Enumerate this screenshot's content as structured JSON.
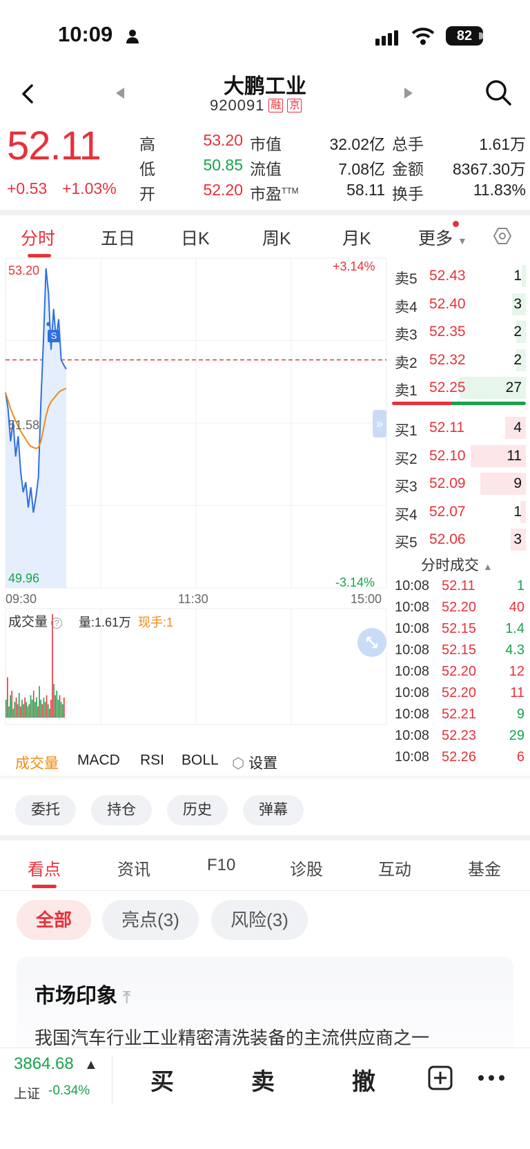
{
  "status": {
    "time": "10:09",
    "battery": "82"
  },
  "header": {
    "name": "大鹏工业",
    "code": "920091",
    "tag1": "融",
    "tag2": "京"
  },
  "quote": {
    "price": "52.11",
    "change": "+0.53",
    "change_pct": "+1.03%",
    "labels": {
      "high": "高",
      "low": "低",
      "open": "开",
      "mkt_cap": "市值",
      "float_cap": "流值",
      "pe": "市盈",
      "pe_sup": "TTM",
      "volume": "总手",
      "amount": "金额",
      "turnover": "换手"
    },
    "values": {
      "high": "53.20",
      "low": "50.85",
      "open": "52.20",
      "mkt_cap": "32.02亿",
      "float_cap": "7.08亿",
      "pe": "58.11",
      "volume": "1.61万",
      "amount": "8367.30万",
      "turnover": "11.83%"
    }
  },
  "chart_tabs": [
    "分时",
    "五日",
    "日K",
    "周K",
    "月K",
    "更多"
  ],
  "chart": {
    "y_high": "53.20",
    "y_mid": "51.58",
    "y_low": "49.96",
    "pct_high": "+3.14%",
    "pct_low": "-3.14%",
    "x_labels": [
      "09:30",
      "11:30",
      "15:00"
    ],
    "marker": "S",
    "volume_label": "成交量",
    "volume_value": "量:1.61万",
    "current_hand": "现手:1"
  },
  "chart_data": {
    "type": "line",
    "title": "",
    "ylim": [
      49.96,
      53.2
    ],
    "series": [
      {
        "values": [
          51.88,
          51.72,
          51.4,
          51.6,
          51.25,
          51.45,
          51.1,
          50.9,
          51.0,
          50.75,
          50.95,
          50.7,
          50.85,
          51.05,
          51.8,
          52.4,
          53.1,
          52.85,
          52.3,
          52.7,
          52.4,
          52.6,
          52.2,
          52.15,
          52.11
        ]
      },
      {
        "values": [
          51.88,
          51.8,
          51.72,
          51.66,
          51.6,
          51.55,
          51.5,
          51.46,
          51.42,
          51.38,
          51.35,
          51.34,
          51.33,
          51.34,
          51.4,
          51.52,
          51.65,
          51.74,
          51.79,
          51.82,
          51.85,
          51.88,
          51.9,
          51.91,
          51.92
        ]
      }
    ],
    "reference_line": 52.2,
    "volume": [
      8,
      18,
      5,
      10,
      12,
      4,
      7,
      9,
      6,
      11,
      5,
      8,
      6,
      9,
      7,
      5,
      6,
      10,
      8,
      12,
      7,
      9,
      5,
      14,
      8,
      6,
      9,
      7,
      10,
      6,
      4,
      8,
      46,
      15,
      10,
      12,
      8,
      10,
      7,
      6,
      9
    ]
  },
  "orderbook": {
    "asks": [
      {
        "label": "卖5",
        "price": "52.43",
        "vol": "1",
        "fill": 0.03
      },
      {
        "label": "卖4",
        "price": "52.40",
        "vol": "3",
        "fill": 0.1
      },
      {
        "label": "卖3",
        "price": "52.35",
        "vol": "2",
        "fill": 0.07
      },
      {
        "label": "卖2",
        "price": "52.32",
        "vol": "2",
        "fill": 0.07
      },
      {
        "label": "卖1",
        "price": "52.25",
        "vol": "27",
        "fill": 0.48
      }
    ],
    "bids": [
      {
        "label": "买1",
        "price": "52.11",
        "vol": "4",
        "fill": 0.15
      },
      {
        "label": "买2",
        "price": "52.10",
        "vol": "11",
        "fill": 0.4
      },
      {
        "label": "买3",
        "price": "52.09",
        "vol": "9",
        "fill": 0.33
      },
      {
        "label": "买4",
        "price": "52.07",
        "vol": "1",
        "fill": 0.04
      },
      {
        "label": "买5",
        "price": "52.06",
        "vol": "3",
        "fill": 0.11
      }
    ]
  },
  "trades": {
    "title": "分时成交",
    "rows": [
      {
        "time": "10:08",
        "price": "52.11",
        "vol": "1",
        "dir": "down"
      },
      {
        "time": "10:08",
        "price": "52.20",
        "vol": "40",
        "dir": "up"
      },
      {
        "time": "10:08",
        "price": "52.15",
        "vol": "1.4",
        "dir": "down"
      },
      {
        "time": "10:08",
        "price": "52.15",
        "vol": "4.3",
        "dir": "down"
      },
      {
        "time": "10:08",
        "price": "52.20",
        "vol": "12",
        "dir": "up"
      },
      {
        "time": "10:08",
        "price": "52.20",
        "vol": "11",
        "dir": "up"
      },
      {
        "time": "10:08",
        "price": "52.21",
        "vol": "9",
        "dir": "down"
      },
      {
        "time": "10:08",
        "price": "52.23",
        "vol": "29",
        "dir": "down"
      },
      {
        "time": "10:08",
        "price": "52.26",
        "vol": "6",
        "dir": "up"
      }
    ]
  },
  "indicator_tabs": [
    "成交量",
    "MACD",
    "RSI",
    "BOLL",
    "设置"
  ],
  "action_pills": [
    "委托",
    "持仓",
    "历史",
    "弹幕"
  ],
  "content_tabs": [
    "看点",
    "资讯",
    "F10",
    "诊股",
    "互动",
    "基金"
  ],
  "filters": [
    "全部",
    "亮点(3)",
    "风险(3)"
  ],
  "card": {
    "title": "市场印象",
    "text": "我国汽车行业工业精密清洗装备的主流供应商之一"
  },
  "bottom": {
    "index_value": "3864.68",
    "index_name": "上证",
    "index_change": "-0.34%",
    "buy": "买",
    "sell": "卖",
    "cancel": "撤"
  },
  "colors": {
    "up": "#e8303a",
    "down": "#16a34a",
    "line": "#2f6fe0",
    "avg": "#f08a18"
  }
}
